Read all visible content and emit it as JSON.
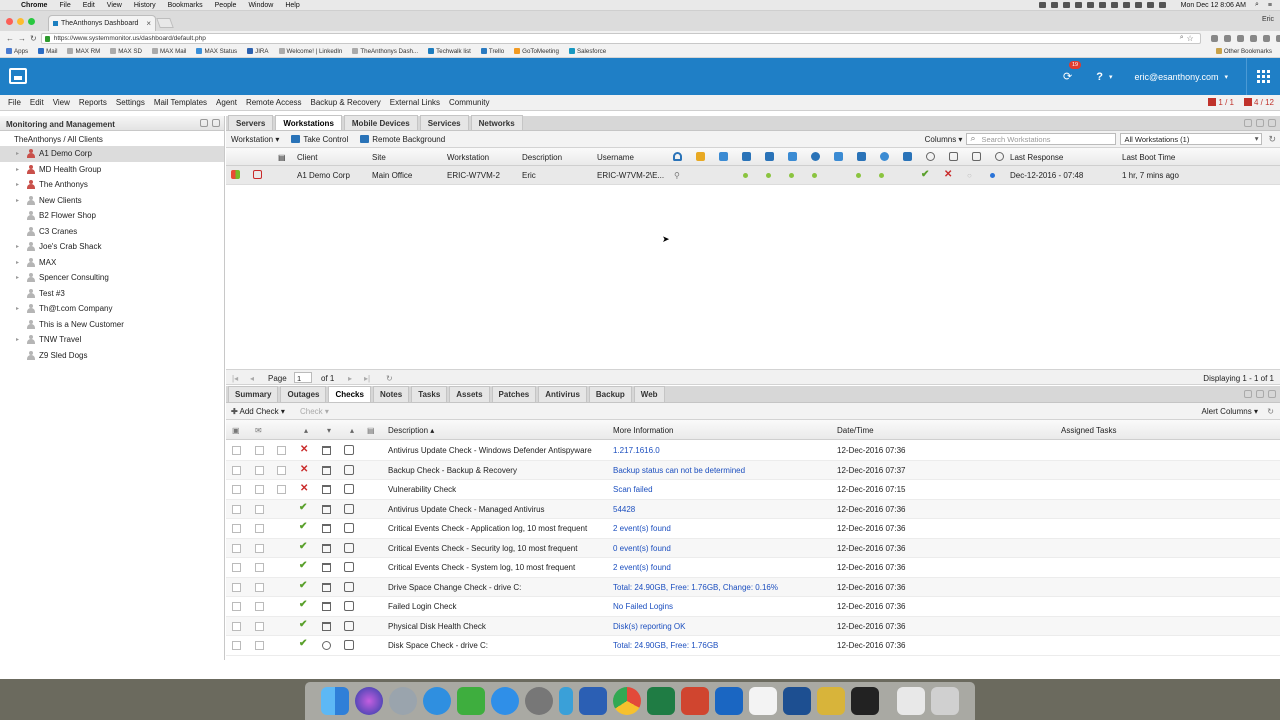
{
  "mac": {
    "app": "Chrome",
    "menus": [
      "File",
      "Edit",
      "View",
      "History",
      "Bookmarks",
      "People",
      "Window",
      "Help"
    ],
    "datetime": "Mon Dec 12 8:06 AM",
    "user": "Eric"
  },
  "browser": {
    "tab_title": "TheAnthonys Dashboard",
    "url": "https://www.systemmonitor.us/dashboard/default.php",
    "bookmarks": [
      "Apps",
      "Mail",
      "MAX RM",
      "MAX SD",
      "MAX Mail",
      "MAX Status",
      "JIRA",
      "Welcome! | LinkedIn",
      "TheAnthonys Dash...",
      "Techwalk list",
      "Trello",
      "GoToMeeting",
      "Salesforce"
    ],
    "other_bookmarks": "Other Bookmarks"
  },
  "header": {
    "notification_count": "19",
    "user_email": "eric@esanthony.com"
  },
  "appmenu": {
    "items": [
      "File",
      "Edit",
      "View",
      "Reports",
      "Settings",
      "Mail Templates",
      "Agent",
      "Remote Access",
      "Backup & Recovery",
      "External Links",
      "Community"
    ],
    "alert1": "1 / 1",
    "alert2": "4 / 12"
  },
  "sidebar": {
    "title": "Monitoring and Management",
    "root": "TheAnthonys / All Clients",
    "items": [
      {
        "label": "A1 Demo Corp",
        "status": "red"
      },
      {
        "label": "MD Health Group",
        "status": "red"
      },
      {
        "label": "The Anthonys",
        "status": "red"
      },
      {
        "label": "New Clients",
        "status": "grey"
      },
      {
        "label": "B2 Flower Shop",
        "status": "grey"
      },
      {
        "label": "C3 Cranes",
        "status": "grey"
      },
      {
        "label": "Joe's Crab Shack",
        "status": "grey"
      },
      {
        "label": "MAX",
        "status": "grey"
      },
      {
        "label": "Spencer Consulting",
        "status": "grey"
      },
      {
        "label": "Test #3",
        "status": "grey"
      },
      {
        "label": "Th@t.com Company",
        "status": "grey"
      },
      {
        "label": "This is a New Customer",
        "status": "grey"
      },
      {
        "label": "TNW Travel",
        "status": "grey"
      },
      {
        "label": "Z9 Sled Dogs",
        "status": "grey"
      }
    ]
  },
  "top_tabs": [
    "Servers",
    "Workstations",
    "Mobile Devices",
    "Services",
    "Networks"
  ],
  "toolbar": {
    "workstation": "Workstation",
    "take_control": "Take Control",
    "remote_background": "Remote Background",
    "columns": "Columns",
    "search_placeholder": "Search Workstations",
    "filter": "All Workstations (1)"
  },
  "ws_grid": {
    "headers": {
      "client": "Client",
      "site": "Site",
      "workstation": "Workstation",
      "description": "Description",
      "username": "Username",
      "last_response": "Last Response",
      "last_boot": "Last Boot Time"
    },
    "row": {
      "client": "A1 Demo Corp",
      "site": "Main Office",
      "workstation": "ERIC-W7VM-2",
      "description": "Eric",
      "username": "ERIC-W7VM-2\\E...",
      "last_response": "Dec-12-2016 - 07:48",
      "last_boot": "1 hr, 7 mins ago"
    }
  },
  "pager": {
    "page_label": "Page",
    "page": "1",
    "of": "of 1",
    "displaying": "Displaying 1 - 1 of 1"
  },
  "lower_tabs": [
    "Summary",
    "Outages",
    "Checks",
    "Notes",
    "Tasks",
    "Assets",
    "Patches",
    "Antivirus",
    "Backup",
    "Web"
  ],
  "lower_toolbar": {
    "add_check": "Add Check",
    "check": "Check",
    "alert_columns": "Alert Columns"
  },
  "checks": {
    "headers": {
      "description": "Description",
      "more_info": "More Information",
      "datetime": "Date/Time",
      "assigned": "Assigned Tasks"
    },
    "rows": [
      {
        "status": "fail",
        "description": "Antivirus Update Check - Windows Defender Antispyware",
        "info": "1.217.1616.0",
        "datetime": "12-Dec-2016 07:36"
      },
      {
        "status": "fail",
        "description": "Backup Check - Backup & Recovery",
        "info": "Backup status can not be determined",
        "datetime": "12-Dec-2016 07:37"
      },
      {
        "status": "fail",
        "description": "Vulnerability Check",
        "info": "Scan failed",
        "datetime": "12-Dec-2016 07:15"
      },
      {
        "status": "pass",
        "description": "Antivirus Update Check - Managed Antivirus",
        "info": "54428",
        "datetime": "12-Dec-2016 07:36"
      },
      {
        "status": "pass",
        "description": "Critical Events Check - Application log, 10 most frequent",
        "info": "2 event(s) found",
        "datetime": "12-Dec-2016 07:36"
      },
      {
        "status": "pass",
        "description": "Critical Events Check - Security log, 10 most frequent",
        "info": "0 event(s) found",
        "datetime": "12-Dec-2016 07:36"
      },
      {
        "status": "pass",
        "description": "Critical Events Check - System log, 10 most frequent",
        "info": "2 event(s) found",
        "datetime": "12-Dec-2016 07:36"
      },
      {
        "status": "pass",
        "description": "Drive Space Change Check - drive C:",
        "info": "Total: 24.90GB, Free: 1.76GB, Change: 0.16%",
        "datetime": "12-Dec-2016 07:36"
      },
      {
        "status": "pass",
        "description": "Failed Login Check",
        "info": "No Failed Logins",
        "datetime": "12-Dec-2016 07:36"
      },
      {
        "status": "pass",
        "description": "Physical Disk Health Check",
        "info": "Disk(s) reporting OK",
        "datetime": "12-Dec-2016 07:36"
      },
      {
        "status": "pass",
        "description": "Disk Space Check - drive C:",
        "info": "Total: 24.90GB, Free: 1.76GB",
        "datetime": "12-Dec-2016 07:36"
      }
    ]
  },
  "colors": {
    "brand": "#1f7fc6",
    "fail": "#c92a2a",
    "pass": "#5aa02c",
    "link": "#1c4fbf"
  }
}
